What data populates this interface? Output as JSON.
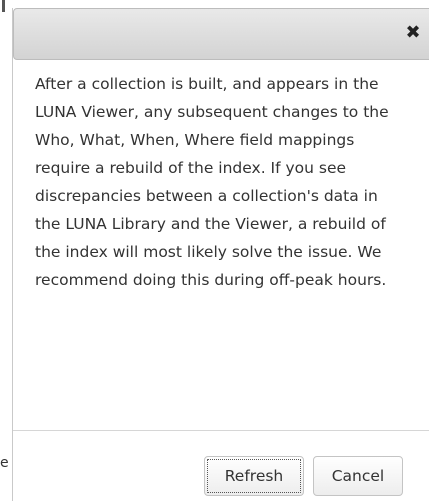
{
  "left_edge": {
    "partial_text": "e"
  },
  "dialog": {
    "close_icon": "close-icon",
    "message_lines": [
      "After a collection is built, and appears in the",
      "LUNA Viewer, any subsequent changes to the",
      "Who, What, When, Where field mappings",
      "require a rebuild of the index. If you see",
      "discrepancies between a collection's data in",
      "the LUNA Library and the Viewer, a rebuild of",
      "the index will most likely solve the issue. We",
      "recommend doing this during off-peak hours."
    ],
    "buttons": {
      "refresh_label": "Refresh",
      "cancel_label": "Cancel"
    }
  }
}
